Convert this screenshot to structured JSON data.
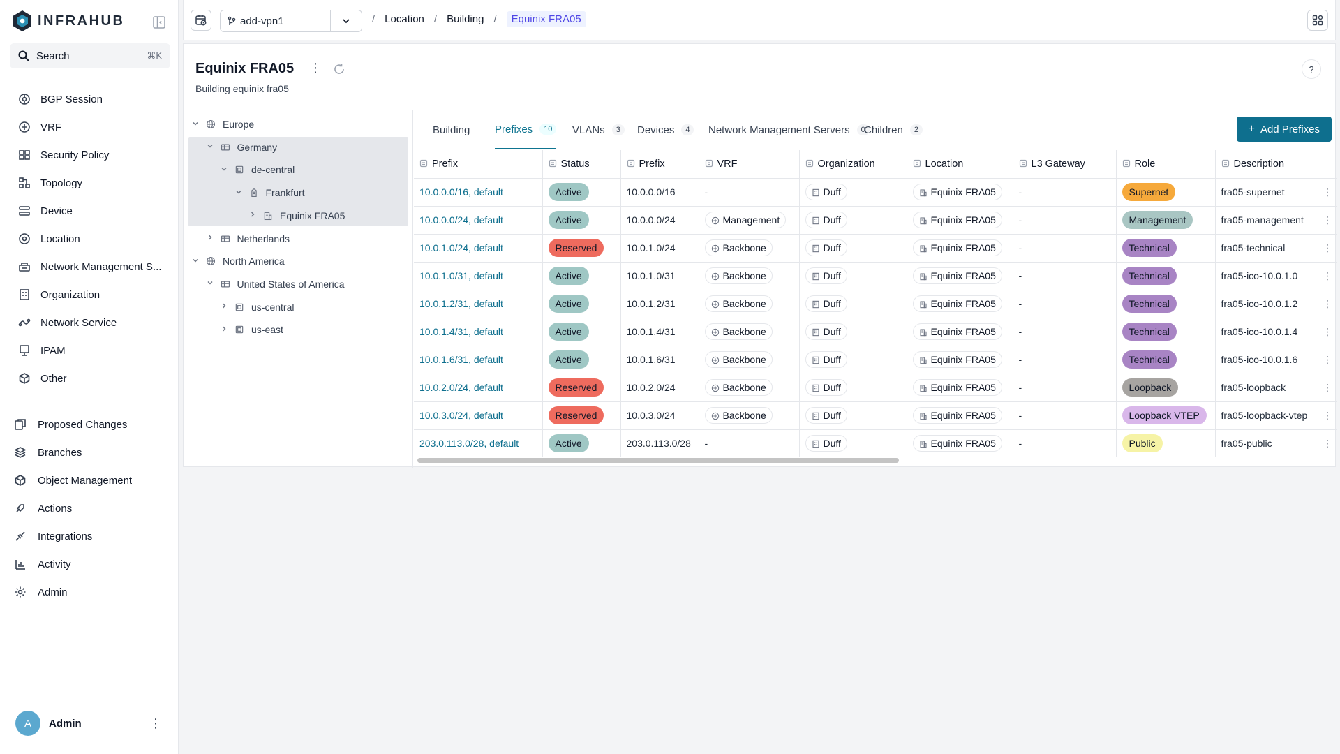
{
  "app": {
    "name": "INFRAHUB"
  },
  "search": {
    "label": "Search",
    "shortcut": "⌘K"
  },
  "sidebar": {
    "items": [
      {
        "label": "BGP Session",
        "icon": "bgp-icon"
      },
      {
        "label": "VRF",
        "icon": "vrf-icon"
      },
      {
        "label": "Security Policy",
        "icon": "security-policy-icon"
      },
      {
        "label": "Topology",
        "icon": "topology-icon"
      },
      {
        "label": "Device",
        "icon": "device-icon"
      },
      {
        "label": "Location",
        "icon": "location-icon"
      },
      {
        "label": "Network Management S...",
        "icon": "network-management-icon"
      },
      {
        "label": "Organization",
        "icon": "organization-icon"
      },
      {
        "label": "Network Service",
        "icon": "network-service-icon"
      },
      {
        "label": "IPAM",
        "icon": "ipam-icon"
      },
      {
        "label": "Other",
        "icon": "other-icon"
      }
    ],
    "items2": [
      {
        "label": "Proposed Changes",
        "icon": "proposed-changes-icon"
      },
      {
        "label": "Branches",
        "icon": "branches-icon"
      },
      {
        "label": "Object Management",
        "icon": "object-management-icon"
      },
      {
        "label": "Actions",
        "icon": "actions-icon"
      },
      {
        "label": "Integrations",
        "icon": "integrations-icon"
      },
      {
        "label": "Activity",
        "icon": "activity-icon"
      },
      {
        "label": "Admin",
        "icon": "admin-icon"
      }
    ],
    "user": {
      "initial": "A",
      "name": "Admin"
    }
  },
  "topbar": {
    "branch": "add-vpn1",
    "breadcrumbs": [
      "Location",
      "Building",
      "Equinix FRA05"
    ]
  },
  "page": {
    "title": "Equinix FRA05",
    "subtitle": "Building equinix fra05",
    "help": "?"
  },
  "tree": [
    {
      "label": "Europe",
      "depth": 0,
      "toggle": "v",
      "icon": "globe-icon"
    },
    {
      "label": "Germany",
      "depth": 1,
      "toggle": "v",
      "icon": "country-icon"
    },
    {
      "label": "de-central",
      "depth": 2,
      "toggle": "v",
      "icon": "region-icon"
    },
    {
      "label": "Frankfurt",
      "depth": 3,
      "toggle": "v",
      "icon": "city-icon"
    },
    {
      "label": "Equinix FRA05",
      "depth": 4,
      "toggle": ">",
      "icon": "building-icon"
    },
    {
      "label": "Netherlands",
      "depth": 1,
      "toggle": ">",
      "icon": "country-icon"
    },
    {
      "label": "North America",
      "depth": 0,
      "toggle": "v",
      "icon": "globe-icon"
    },
    {
      "label": "United States of America",
      "depth": 1,
      "toggle": "v",
      "icon": "country-icon"
    },
    {
      "label": "us-central",
      "depth": 2,
      "toggle": ">",
      "icon": "region-icon"
    },
    {
      "label": "us-east",
      "depth": 2,
      "toggle": ">",
      "icon": "region-icon"
    }
  ],
  "tabs": [
    {
      "label": "Building",
      "count": ""
    },
    {
      "label": "Prefixes",
      "count": "10"
    },
    {
      "label": "VLANs",
      "count": "3"
    },
    {
      "label": "Devices",
      "count": "4"
    },
    {
      "label": "Network Management Servers",
      "count": "0"
    },
    {
      "label": "Children",
      "count": "2"
    }
  ],
  "active_tab": "Prefixes",
  "add_button": "Add Prefixes",
  "table": {
    "headers": [
      "Prefix",
      "Status",
      "Prefix",
      "VRF",
      "Organization",
      "Location",
      "L3 Gateway",
      "Role",
      "Description"
    ],
    "rows": [
      {
        "link": "10.0.0.0/16, default",
        "status": "Active",
        "prefix": "10.0.0.0/16",
        "vrf": "-",
        "org": "Duff",
        "location": "Equinix FRA05",
        "gw": "-",
        "role": "Supernet",
        "desc": "fra05-supernet"
      },
      {
        "link": "10.0.0.0/24, default",
        "status": "Active",
        "prefix": "10.0.0.0/24",
        "vrf": "Management",
        "org": "Duff",
        "location": "Equinix FRA05",
        "gw": "-",
        "role": "Management",
        "desc": "fra05-management"
      },
      {
        "link": "10.0.1.0/24, default",
        "status": "Reserved",
        "prefix": "10.0.1.0/24",
        "vrf": "Backbone",
        "org": "Duff",
        "location": "Equinix FRA05",
        "gw": "-",
        "role": "Technical",
        "desc": "fra05-technical"
      },
      {
        "link": "10.0.1.0/31, default",
        "status": "Active",
        "prefix": "10.0.1.0/31",
        "vrf": "Backbone",
        "org": "Duff",
        "location": "Equinix FRA05",
        "gw": "-",
        "role": "Technical",
        "desc": "fra05-ico-10.0.1.0"
      },
      {
        "link": "10.0.1.2/31, default",
        "status": "Active",
        "prefix": "10.0.1.2/31",
        "vrf": "Backbone",
        "org": "Duff",
        "location": "Equinix FRA05",
        "gw": "-",
        "role": "Technical",
        "desc": "fra05-ico-10.0.1.2"
      },
      {
        "link": "10.0.1.4/31, default",
        "status": "Active",
        "prefix": "10.0.1.4/31",
        "vrf": "Backbone",
        "org": "Duff",
        "location": "Equinix FRA05",
        "gw": "-",
        "role": "Technical",
        "desc": "fra05-ico-10.0.1.4"
      },
      {
        "link": "10.0.1.6/31, default",
        "status": "Active",
        "prefix": "10.0.1.6/31",
        "vrf": "Backbone",
        "org": "Duff",
        "location": "Equinix FRA05",
        "gw": "-",
        "role": "Technical",
        "desc": "fra05-ico-10.0.1.6"
      },
      {
        "link": "10.0.2.0/24, default",
        "status": "Reserved",
        "prefix": "10.0.2.0/24",
        "vrf": "Backbone",
        "org": "Duff",
        "location": "Equinix FRA05",
        "gw": "-",
        "role": "Loopback",
        "desc": "fra05-loopback"
      },
      {
        "link": "10.0.3.0/24, default",
        "status": "Reserved",
        "prefix": "10.0.3.0/24",
        "vrf": "Backbone",
        "org": "Duff",
        "location": "Equinix FRA05",
        "gw": "-",
        "role": "Loopback VTEP",
        "desc": "fra05-loopback-vtep"
      },
      {
        "link": "203.0.113.0/28, default",
        "status": "Active",
        "prefix": "203.0.113.0/28",
        "vrf": "-",
        "org": "Duff",
        "location": "Equinix FRA05",
        "gw": "-",
        "role": "Public",
        "desc": "fra05-public"
      }
    ]
  },
  "colors": {
    "accent": "#0e6f8e",
    "status": {
      "Active": "#9fc7c4",
      "Reserved": "#ee6b5e"
    },
    "role": {
      "Supernet": "#f6a93b",
      "Management": "#a9c6c3",
      "Technical": "#a884c4",
      "Loopback": "#a7a4a1",
      "Loopback VTEP": "#d9b7ea",
      "Public": "#f6f3a6"
    }
  }
}
